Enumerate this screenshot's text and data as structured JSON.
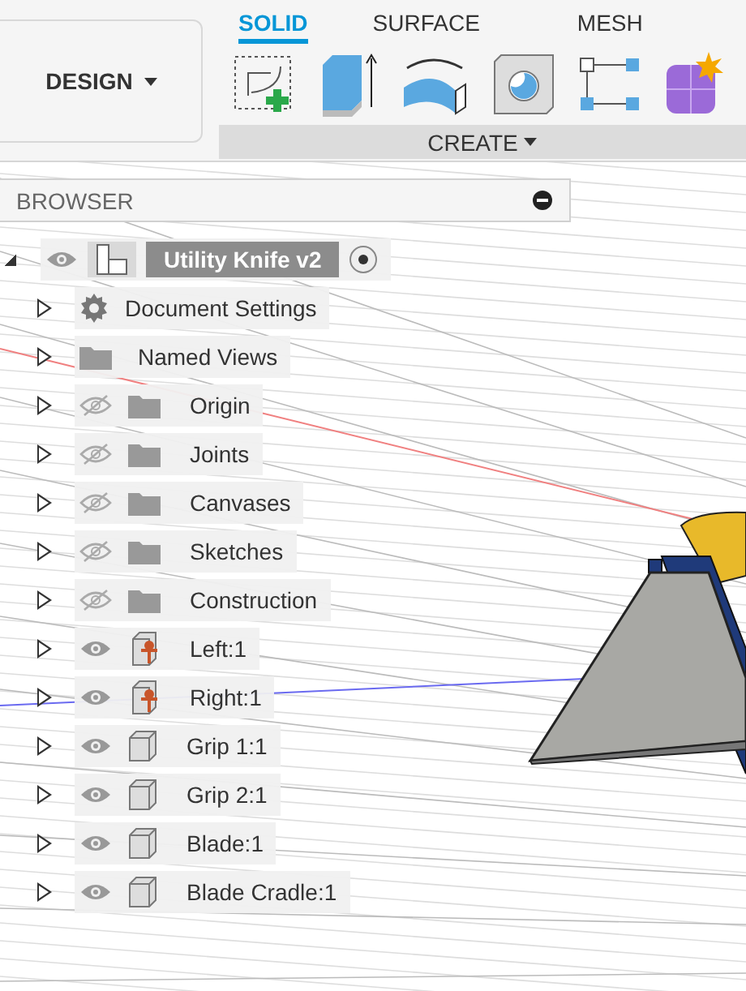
{
  "workspace": {
    "label": "DESIGN"
  },
  "tabs": [
    {
      "label": "SOLID",
      "selected": true
    },
    {
      "label": "SURFACE",
      "selected": false
    },
    {
      "label": "MESH",
      "selected": false
    }
  ],
  "tool_group": {
    "label": "CREATE"
  },
  "browser": {
    "title": "BROWSER"
  },
  "tree": {
    "label": "Utility Knife v2",
    "expanded": true,
    "visible": true,
    "active": true,
    "children": [
      {
        "label": "Document Settings",
        "kind": "settings",
        "expanded": false
      },
      {
        "label": "Named Views",
        "kind": "folder",
        "expanded": false
      },
      {
        "label": "Origin",
        "kind": "folder",
        "visible": false,
        "expanded": false
      },
      {
        "label": "Joints",
        "kind": "folder",
        "visible": false,
        "expanded": false
      },
      {
        "label": "Canvases",
        "kind": "folder",
        "visible": false,
        "expanded": false
      },
      {
        "label": "Sketches",
        "kind": "folder",
        "visible": false,
        "expanded": false
      },
      {
        "label": "Construction",
        "kind": "folder",
        "visible": false,
        "expanded": false
      },
      {
        "label": "Left:1",
        "kind": "link",
        "visible": true,
        "expanded": false
      },
      {
        "label": "Right:1",
        "kind": "link",
        "visible": true,
        "expanded": false
      },
      {
        "label": "Grip 1:1",
        "kind": "component",
        "visible": true,
        "expanded": false
      },
      {
        "label": "Grip 2:1",
        "kind": "component",
        "visible": true,
        "expanded": false
      },
      {
        "label": "Blade:1",
        "kind": "component",
        "visible": true,
        "expanded": false
      },
      {
        "label": "Blade Cradle:1",
        "kind": "component",
        "visible": true,
        "expanded": false
      }
    ]
  }
}
